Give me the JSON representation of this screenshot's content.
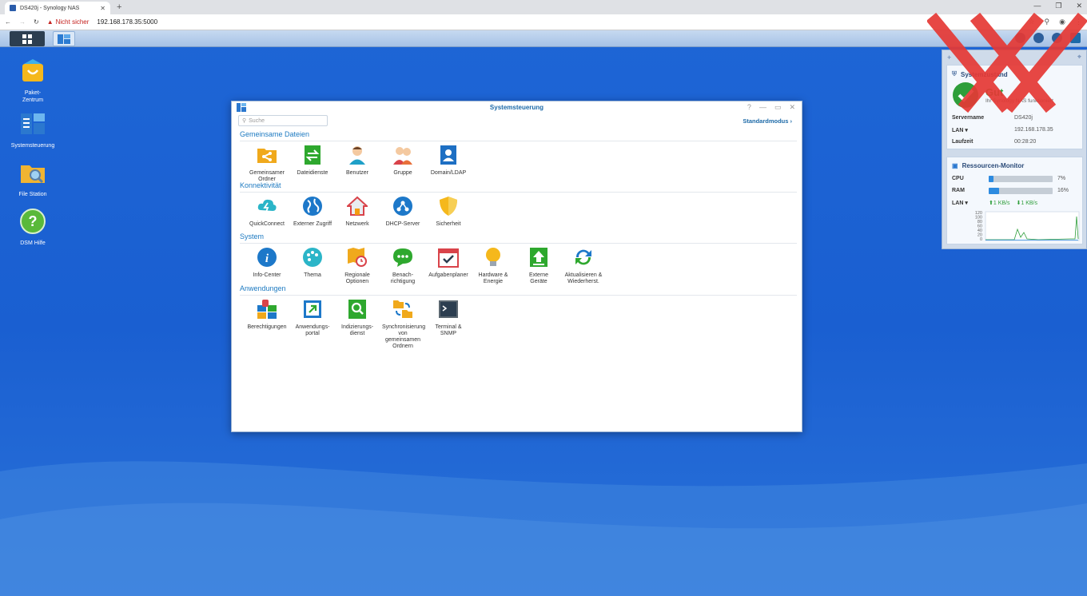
{
  "browser": {
    "tab_title": "DS420j - Synology NAS",
    "new_tab": "+",
    "security": "Nicht sicher",
    "url": "192.168.178.35:5000"
  },
  "desktop": {
    "icons": [
      {
        "label": "Paket-\nZentrum"
      },
      {
        "label": "Systemsteuerung"
      },
      {
        "label": "File Station"
      },
      {
        "label": "DSM Hilfe"
      }
    ]
  },
  "window": {
    "title": "Systemsteuerung",
    "search_placeholder": "Suche",
    "mode": "Standardmodus",
    "sections": [
      {
        "title": "Gemeinsame Dateien",
        "items": [
          "Gemeinsamer Ordner",
          "Dateidienste",
          "Benutzer",
          "Gruppe",
          "Domain/LDAP"
        ]
      },
      {
        "title": "Konnektivität",
        "items": [
          "QuickConnect",
          "Externer Zugriff",
          "Netzwerk",
          "DHCP-Server",
          "Sicherheit"
        ]
      },
      {
        "title": "System",
        "items": [
          "Info-Center",
          "Thema",
          "Regionale Optionen",
          "Benach-richtigung",
          "Aufgabenplaner",
          "Hardware & Energie",
          "Externe Geräte",
          "Aktualisieren & Wiederherst."
        ]
      },
      {
        "title": "Anwendungen",
        "items": [
          "Berechtigungen",
          "Anwendungs-portal",
          "Indizierungs-dienst",
          "Synchronisierung von gemeinsamen Ordnern",
          "Terminal & SNMP"
        ]
      }
    ]
  },
  "widgets": {
    "health": {
      "title": "Systemzustand",
      "status": "Gut",
      "message": "Ihr Synology NAS funktioniert",
      "rows": [
        {
          "k": "Servername",
          "v": "DS420j"
        },
        {
          "k": "LAN",
          "v": "192.168.178.35"
        },
        {
          "k": "Laufzeit",
          "v": "00:28:20"
        }
      ]
    },
    "monitor": {
      "title": "Ressourcen-Monitor",
      "cpu_label": "CPU",
      "cpu_value": "7%",
      "cpu_fraction": 0.07,
      "ram_label": "RAM",
      "ram_value": "16%",
      "ram_fraction": 0.16,
      "lan_label": "LAN",
      "up": "1 KB/s",
      "down": "1 KB/s",
      "yticks": [
        "120",
        "100",
        "80",
        "60",
        "40",
        "20",
        "0"
      ]
    }
  }
}
